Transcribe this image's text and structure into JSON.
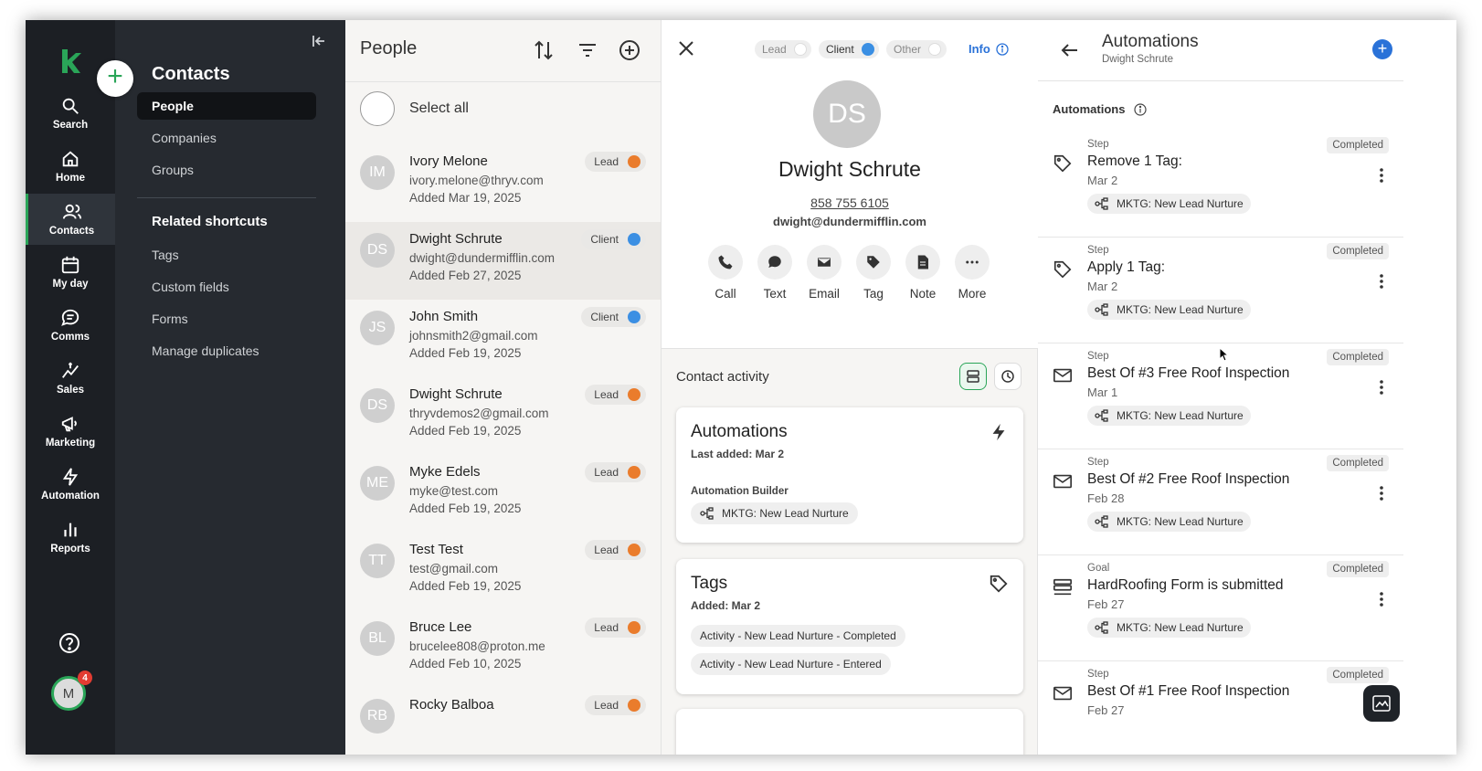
{
  "rail": {
    "items": [
      {
        "label": "Search",
        "icon": "search-icon"
      },
      {
        "label": "Home",
        "icon": "home-icon"
      },
      {
        "label": "Contacts",
        "icon": "contacts-icon"
      },
      {
        "label": "My day",
        "icon": "calendar-icon"
      },
      {
        "label": "Comms",
        "icon": "chat-icon"
      },
      {
        "label": "Sales",
        "icon": "sales-icon"
      },
      {
        "label": "Marketing",
        "icon": "megaphone-icon"
      },
      {
        "label": "Automation",
        "icon": "lightning-icon"
      },
      {
        "label": "Reports",
        "icon": "bar-chart-icon"
      }
    ],
    "avatar_initial": "M",
    "notification_count": "4",
    "accent_color": "#2aa558"
  },
  "subnav": {
    "title": "Contacts",
    "items": [
      "People",
      "Companies",
      "Groups"
    ],
    "shortcuts_heading": "Related shortcuts",
    "shortcuts": [
      "Tags",
      "Custom fields",
      "Forms",
      "Manage duplicates"
    ]
  },
  "people": {
    "title": "People",
    "select_all": "Select all",
    "list": [
      {
        "initials": "IM",
        "name": "Ivory Melone",
        "email": "ivory.melone@thryv.com",
        "added": "Added Mar 19, 2025",
        "status": "Lead",
        "status_color": "#ea7c2c"
      },
      {
        "initials": "DS",
        "name": "Dwight Schrute",
        "email": "dwight@dundermifflin.com",
        "added": "Added Feb 27, 2025",
        "status": "Client",
        "status_color": "#3b8fe3"
      },
      {
        "initials": "JS",
        "name": "John Smith",
        "email": "johnsmith2@gmail.com",
        "added": "Added Feb 19, 2025",
        "status": "Client",
        "status_color": "#3b8fe3"
      },
      {
        "initials": "DS",
        "name": "Dwight Schrute",
        "email": "thryvdemos2@gmail.com",
        "added": "Added Feb 19, 2025",
        "status": "Lead",
        "status_color": "#ea7c2c"
      },
      {
        "initials": "ME",
        "name": "Myke Edels",
        "email": "myke@test.com",
        "added": "Added Feb 19, 2025",
        "status": "Lead",
        "status_color": "#ea7c2c"
      },
      {
        "initials": "TT",
        "name": "Test Test",
        "email": "test@gmail.com",
        "added": "Added Feb 19, 2025",
        "status": "Lead",
        "status_color": "#ea7c2c"
      },
      {
        "initials": "BL",
        "name": "Bruce Lee",
        "email": "brucelee808@proton.me",
        "added": "Added Feb 10, 2025",
        "status": "Lead",
        "status_color": "#ea7c2c"
      },
      {
        "initials": "RB",
        "name": "Rocky Balboa",
        "email": "",
        "added": "",
        "status": "Lead",
        "status_color": "#ea7c2c"
      }
    ]
  },
  "detail": {
    "segments": [
      "Lead",
      "Client",
      "Other"
    ],
    "info_label": "Info",
    "initials": "DS",
    "name": "Dwight Schrute",
    "phone": "858 755 6105",
    "email": "dwight@dundermifflin.com",
    "actions": [
      "Call",
      "Text",
      "Email",
      "Tag",
      "Note",
      "More"
    ],
    "activity_title": "Contact activity",
    "automations_card": {
      "title": "Automations",
      "last_added": "Last added: Mar 2",
      "builder_label": "Automation Builder",
      "chip": "MKTG: New Lead Nurture"
    },
    "tags_card": {
      "title": "Tags",
      "added": "Added: Mar 2",
      "chips": [
        "Activity - New Lead Nurture - Completed",
        "Activity - New Lead Nurture - Entered"
      ]
    }
  },
  "automations": {
    "title": "Automations",
    "subtitle": "Dwight Schrute",
    "section_label": "Automations",
    "steps": [
      {
        "kind": "Step",
        "title": "Remove 1 Tag:",
        "date": "Mar 2",
        "status": "Completed",
        "chip": "MKTG: New Lead Nurture",
        "icon": "tag-icon"
      },
      {
        "kind": "Step",
        "title": "Apply 1 Tag:",
        "date": "Mar 2",
        "status": "Completed",
        "chip": "MKTG: New Lead Nurture",
        "icon": "tag-icon"
      },
      {
        "kind": "Step",
        "title": "Best Of #3 Free Roof Inspection",
        "date": "Mar 1",
        "status": "Completed",
        "chip": "MKTG: New Lead Nurture",
        "icon": "mail-icon"
      },
      {
        "kind": "Step",
        "title": "Best Of #2 Free Roof Inspection",
        "date": "Feb 28",
        "status": "Completed",
        "chip": "MKTG: New Lead Nurture",
        "icon": "mail-icon"
      },
      {
        "kind": "Goal",
        "title": "HardRoofing Form is submitted",
        "date": "Feb 27",
        "status": "Completed",
        "chip": "MKTG: New Lead Nurture",
        "icon": "form-icon"
      },
      {
        "kind": "Step",
        "title": "Best Of #1 Free Roof Inspection",
        "date": "Feb 27",
        "status": "Completed",
        "chip": "",
        "icon": "mail-icon"
      }
    ]
  }
}
